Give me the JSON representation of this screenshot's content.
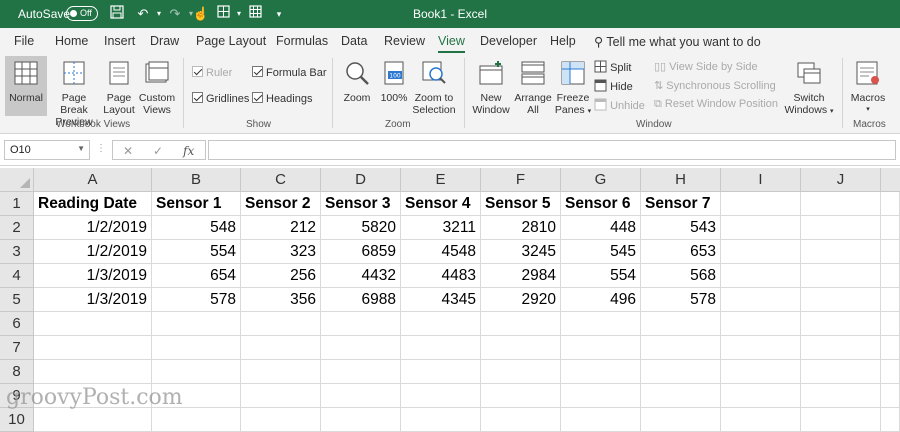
{
  "titlebar": {
    "autosave_label": "AutoSave",
    "autosave_state": "Off",
    "title": "Book1  -  Excel",
    "bg_color": "#217346"
  },
  "menu_tabs": [
    "File",
    "Home",
    "Insert",
    "Draw",
    "Page Layout",
    "Formulas",
    "Data",
    "Review",
    "View",
    "Developer",
    "Help"
  ],
  "active_tab": "View",
  "tell_me": "Tell me what you want to do",
  "ribbon": {
    "workbook_views": {
      "label": "Workbook Views",
      "normal": "Normal",
      "page_break_1": "Page Break",
      "page_break_2": "Preview",
      "page_layout_1": "Page",
      "page_layout_2": "Layout",
      "custom_1": "Custom",
      "custom_2": "Views"
    },
    "show": {
      "label": "Show",
      "ruler": "Ruler",
      "formula_bar": "Formula Bar",
      "gridlines": "Gridlines",
      "headings": "Headings"
    },
    "zoom": {
      "label": "Zoom",
      "zoom": "Zoom",
      "hundred": "100%",
      "zoom_sel_1": "Zoom to",
      "zoom_sel_2": "Selection"
    },
    "window": {
      "label": "Window",
      "new_1": "New",
      "new_2": "Window",
      "arrange_1": "Arrange",
      "arrange_2": "All",
      "freeze_1": "Freeze",
      "freeze_2": "Panes",
      "split": "Split",
      "hide": "Hide",
      "unhide": "Unhide",
      "side_by_side": "View Side by Side",
      "sync_scroll": "Synchronous Scrolling",
      "reset_pos": "Reset Window Position",
      "switch_1": "Switch",
      "switch_2": "Windows"
    },
    "macros": {
      "label": "Macros",
      "macros": "Macros"
    }
  },
  "formula_bar": {
    "name_box": "O10",
    "cancel": "✕",
    "enter": "✓",
    "fx": "fx",
    "value": ""
  },
  "columns": [
    "A",
    "B",
    "C",
    "D",
    "E",
    "F",
    "G",
    "H",
    "I",
    "J"
  ],
  "rows": [
    "1",
    "2",
    "3",
    "4",
    "5",
    "6",
    "7",
    "8",
    "9",
    "10"
  ],
  "sheet": {
    "headers": [
      "Reading Date",
      "Sensor 1",
      "Sensor 2",
      "Sensor 3",
      "Sensor 4",
      "Sensor 5",
      "Sensor 6",
      "Sensor 7"
    ],
    "data": [
      [
        "1/2/2019",
        "548",
        "212",
        "5820",
        "3211",
        "2810",
        "448",
        "543"
      ],
      [
        "1/2/2019",
        "554",
        "323",
        "6859",
        "4548",
        "3245",
        "545",
        "653"
      ],
      [
        "1/3/2019",
        "654",
        "256",
        "4432",
        "4483",
        "2984",
        "554",
        "568"
      ],
      [
        "1/3/2019",
        "578",
        "356",
        "6988",
        "4345",
        "2920",
        "496",
        "578"
      ]
    ]
  },
  "watermark": "groovyPost.com"
}
